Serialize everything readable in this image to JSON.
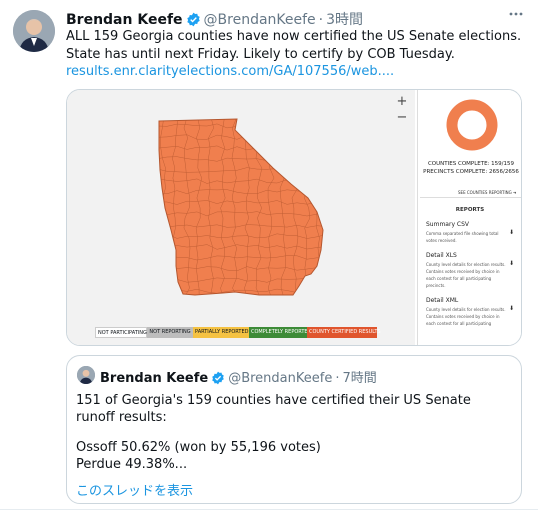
{
  "tweet": {
    "author_name": "Brendan Keefe",
    "handle": "@BrendanKeefe",
    "separator": "·",
    "time": "3時間",
    "more_icon": "more-icon",
    "text": "ALL 159 Georgia counties have now certified the US Senate elections. State has until next Friday. Likely to certify by COB Tuesday.",
    "link": "results.enr.clarityelections.com/GA/107556/web....",
    "verified_color": "#1da1f2"
  },
  "media": {
    "zoom_in": "+",
    "zoom_out": "−",
    "map_fill_color": "#f07f4e",
    "legend": [
      {
        "label": "NOT PARTICIPATING",
        "color": "#ffffff"
      },
      {
        "label": "NOT REPORTING",
        "color": "#bdbdbd"
      },
      {
        "label": "PARTIALLY REPORTED",
        "color": "#f5c242"
      },
      {
        "label": "COMPLETELY REPORTED",
        "color": "#3d8b37"
      },
      {
        "label": "COUNTY CERTIFIED RESULTS",
        "color": "#e0552d"
      }
    ],
    "donut_color": "#f07f4e",
    "donut_fraction": 1.0,
    "counties_complete": "COUNTIES COMPLETE: 159/159",
    "precincts_complete": "PRECINCTS COMPLETE: 2656/2656",
    "see_counties": "SEE COUNTIES REPORTING ➜",
    "reports_title": "REPORTS",
    "reports": [
      {
        "name": "Summary CSV",
        "desc": "Comma separated file showing total votes received.",
        "icon": "download-icon"
      },
      {
        "name": "Detail XLS",
        "desc": "County level details for election results. Contains votes received by choice in each contest for all participating precincts.",
        "icon": "download-icon"
      },
      {
        "name": "Detail XML",
        "desc": "County level details for election results. Contains votes received by choice in each contest for all participating",
        "icon": "download-icon"
      }
    ]
  },
  "quote": {
    "author_name": "Brendan Keefe",
    "handle": "@BrendanKeefe",
    "separator": "·",
    "time": "7時間",
    "line1": "151 of Georgia's 159 counties have certified their US Senate runoff results:",
    "line2": "Ossoff 50.62% (won by 55,196 votes)",
    "line3": "Perdue 49.38%...",
    "show_thread": "このスレッドを表示"
  }
}
